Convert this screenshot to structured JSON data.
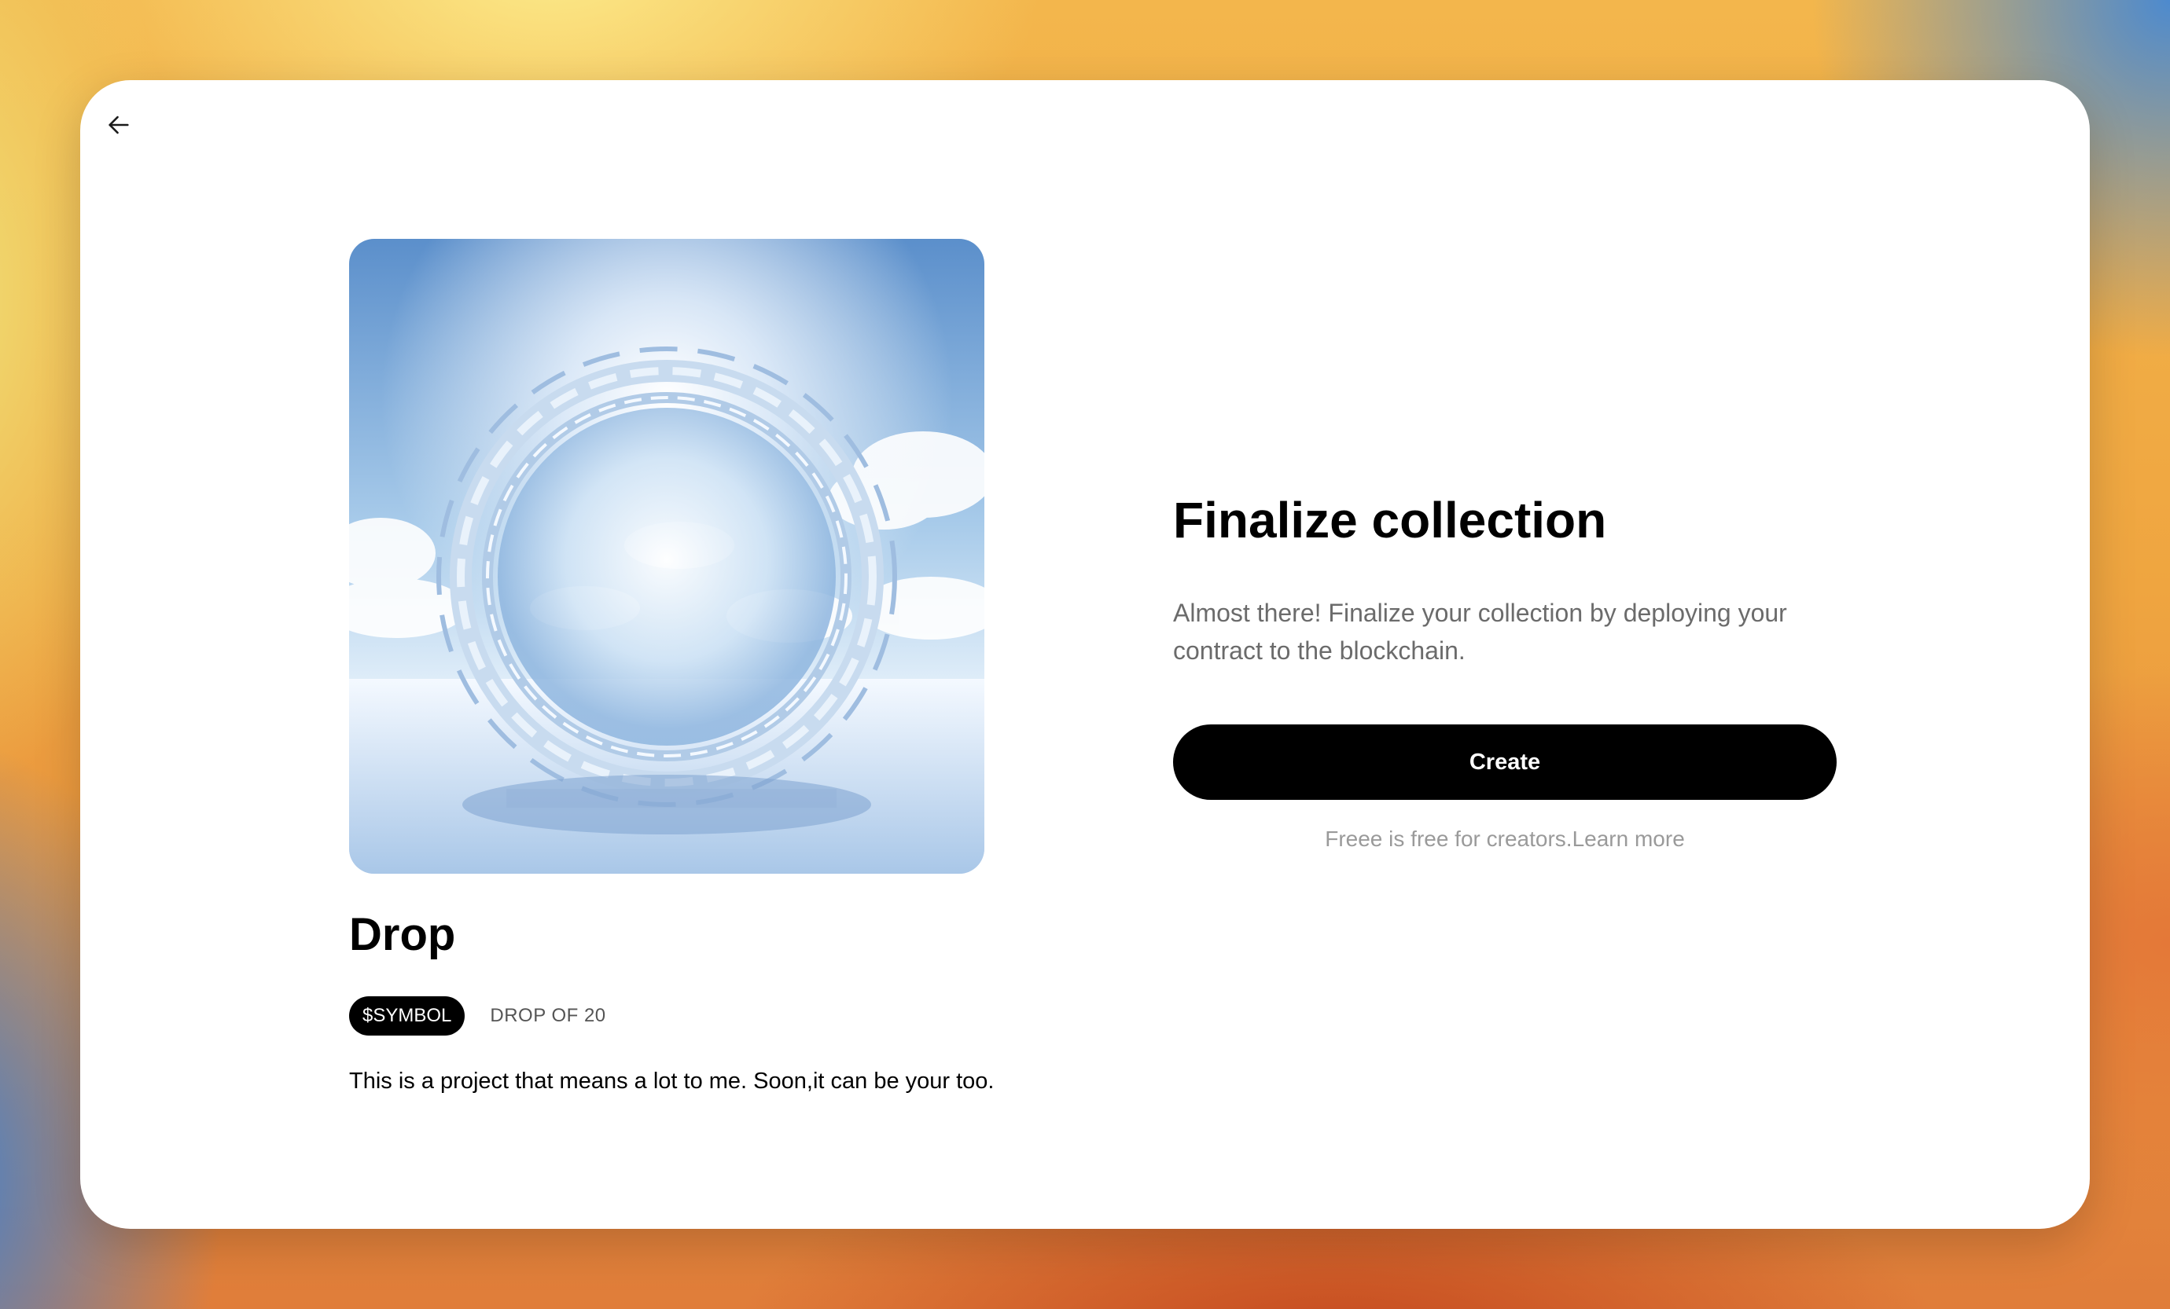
{
  "nav": {
    "back_icon": "arrow-left-icon"
  },
  "collection": {
    "image_alt": "portal-artwork",
    "name": "Drop",
    "symbol": "$SYMBOL",
    "drop_count": "DROP OF 20",
    "description": "This is a project that means a lot to me. Soon,it can be your too."
  },
  "finalize": {
    "title": "Finalize collection",
    "text": "Almost there! Finalize your collection by deploying your contract to the blockchain.",
    "create_label": "Create",
    "footnote_prefix": "Freee is free for creators.",
    "learn_more": "Learn more"
  },
  "colors": {
    "primary_button": "#000000",
    "muted_text": "#6b6b6b",
    "footnote_text": "#9a9a9a"
  }
}
